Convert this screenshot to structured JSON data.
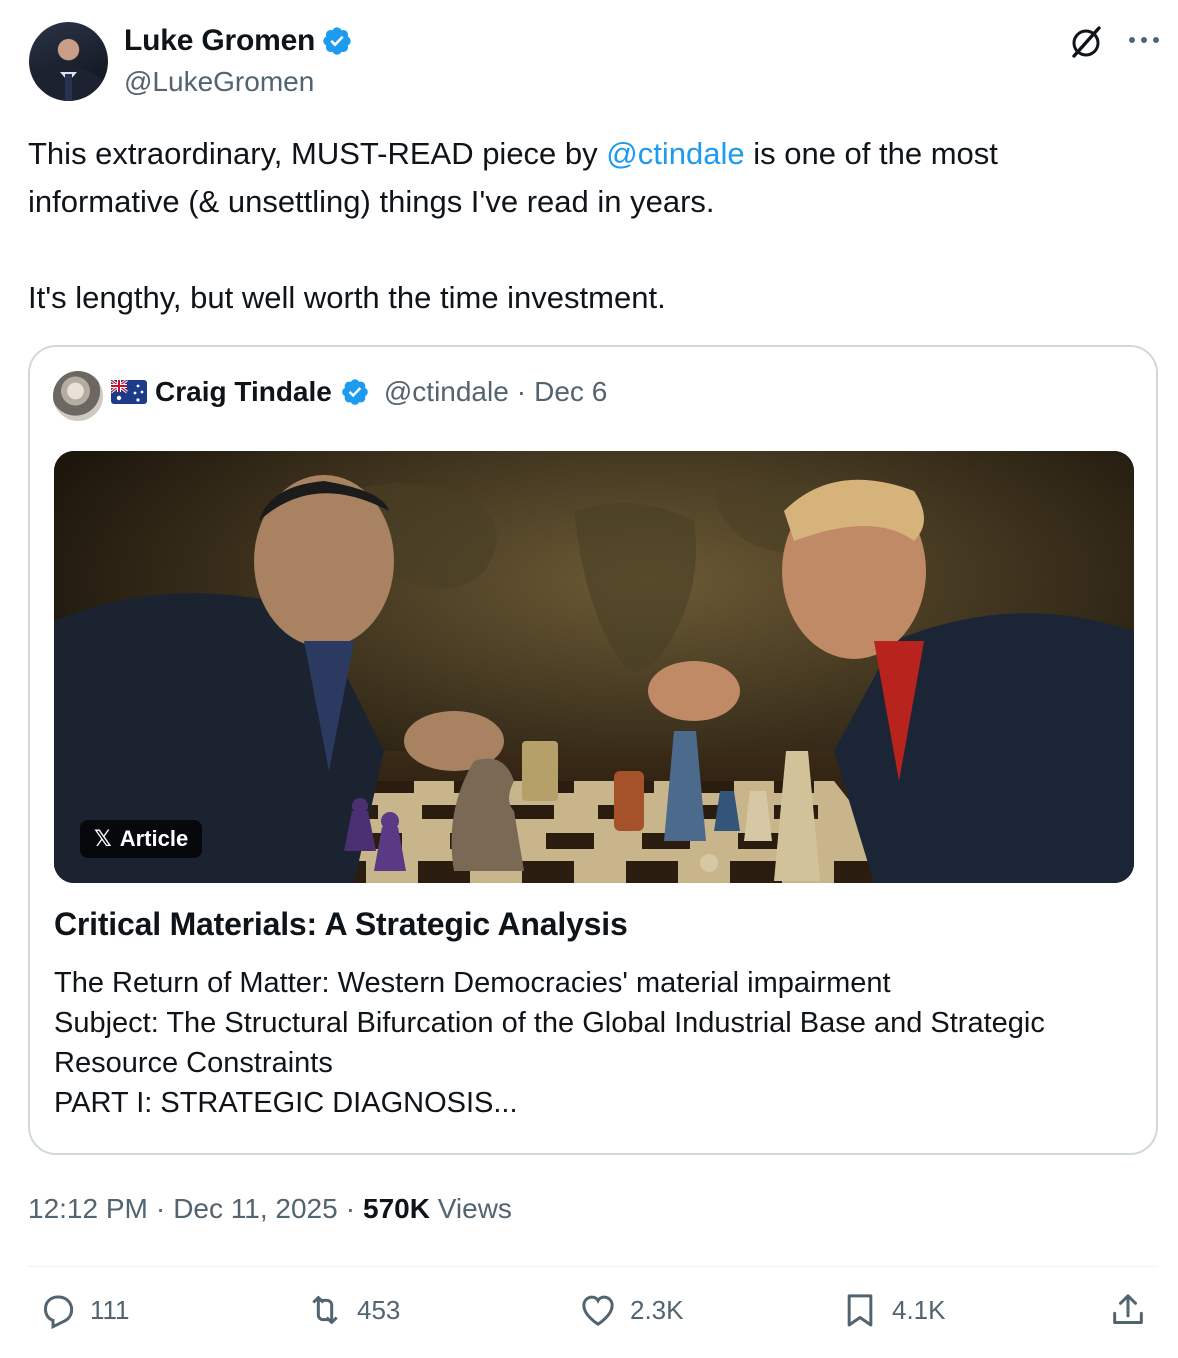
{
  "author": {
    "name": "Luke Gromen",
    "handle": "@LukeGromen",
    "verified": true
  },
  "tweet": {
    "text_before_mention": "This extraordinary, MUST-READ piece by ",
    "mention": "@ctindale",
    "text_after_mention": " is one of the most informative (& unsettling) things I've read in years.",
    "text_paragraph_2": "It's lengthy, but well worth the time investment."
  },
  "quoted": {
    "flag_icon": "australia-flag-icon",
    "name": "Craig Tindale",
    "handle": "@ctindale",
    "separator": "·",
    "date": "Dec 6",
    "badge_label": "Article",
    "article_title": "Critical Materials: A Strategic Analysis",
    "article_lines": [
      "The Return of Matter: Western Democracies' material impairment",
      "Subject: The Structural Bifurcation of the Global Industrial Base and Strategic Resource Constraints",
      "PART I: STRATEGIC DIAGNOSIS..."
    ]
  },
  "meta": {
    "time": "12:12 PM",
    "sep1": "·",
    "date": "Dec 11, 2025",
    "sep2": "·",
    "views_count": "570K",
    "views_label": "Views"
  },
  "actions": {
    "replies": "111",
    "reposts": "453",
    "likes": "2.3K",
    "bookmarks": "4.1K"
  },
  "colors": {
    "accent": "#1d9bf0",
    "muted": "#536471",
    "text": "#0f1419",
    "border": "#cfd9de"
  }
}
